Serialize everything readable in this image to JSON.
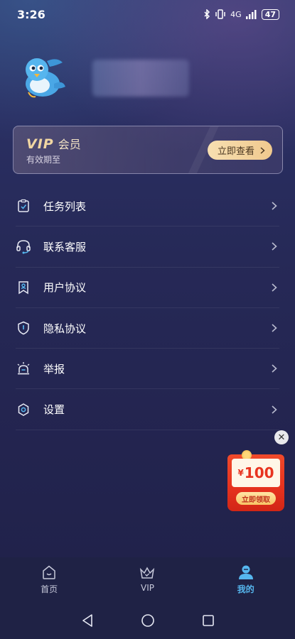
{
  "status_bar": {
    "time": "3:26",
    "network": "4G",
    "battery": "47",
    "icons": [
      "bluetooth-icon",
      "vibrate-icon",
      "signal-icon",
      "battery-icon"
    ]
  },
  "profile": {
    "avatar_icon": "bird-mascot-icon"
  },
  "vip_card": {
    "logo": "VIP",
    "label": "会员",
    "expire_label": "有效期至",
    "button_label": "立即查看",
    "accent_color": "#f0c98e"
  },
  "menu": {
    "items": [
      {
        "label": "任务列表",
        "icon": "task-clipboard-icon"
      },
      {
        "label": "联系客服",
        "icon": "headset-icon"
      },
      {
        "label": "用户协议",
        "icon": "bookmark-user-icon"
      },
      {
        "label": "隐私协议",
        "icon": "shield-icon"
      },
      {
        "label": "举报",
        "icon": "alarm-light-icon"
      },
      {
        "label": "设置",
        "icon": "gear-icon"
      }
    ]
  },
  "coupon": {
    "currency": "¥",
    "amount": "100",
    "button_label": "立即领取",
    "color": "#e8331f"
  },
  "tab_bar": {
    "tabs": [
      {
        "label": "首页",
        "icon": "home-icon",
        "active": false
      },
      {
        "label": "VIP",
        "icon": "crown-icon",
        "active": false
      },
      {
        "label": "我的",
        "icon": "user-icon",
        "active": true
      }
    ],
    "active_color": "#56b7ef"
  },
  "nav_bar": {
    "buttons": [
      "back-triangle-icon",
      "home-circle-icon",
      "recents-square-icon"
    ]
  }
}
